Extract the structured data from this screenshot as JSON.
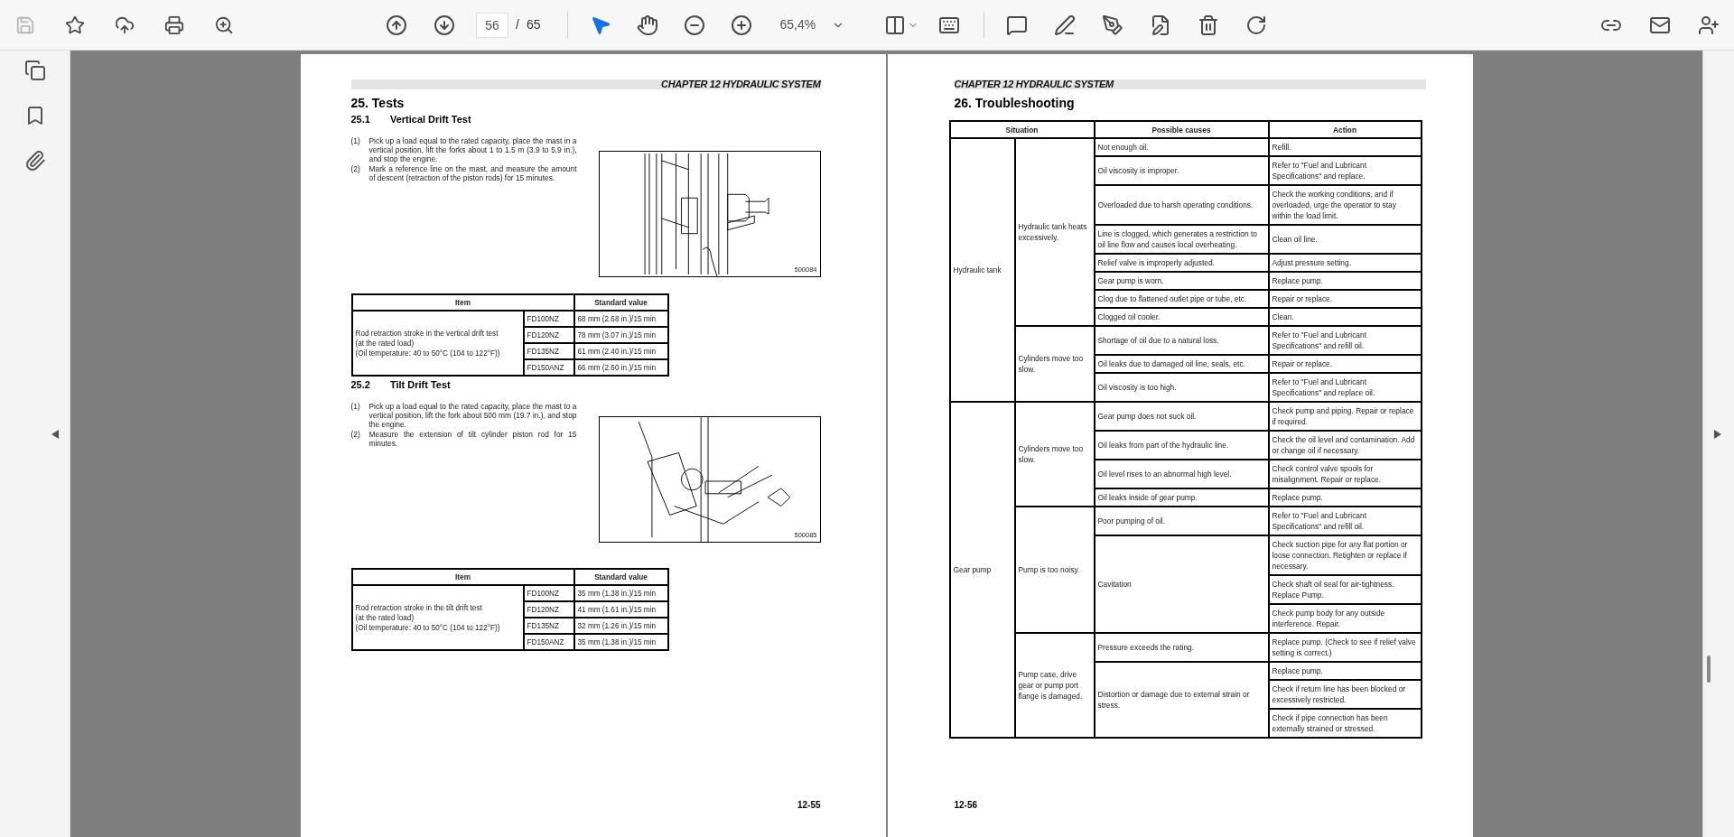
{
  "toolbar": {
    "save_disabled": true,
    "page_number": "56",
    "page_separator": "/",
    "page_total": "65",
    "select_tools": [
      {
        "selected": true
      },
      {
        "selected": false
      }
    ],
    "zoom": "65,4%"
  },
  "pages": [
    {
      "chapter": "CHAPTER 12  HYDRAULIC SYSTEM",
      "folio": "12-55",
      "sections": [
        {
          "heading": "25.  Tests",
          "subheading_number": "25.1",
          "subheading": "Vertical Drift Test",
          "steps": [
            {
              "number": "(1)",
              "text": "Pick up a load equal to the rated capacity, place the mast in a vertical position, lift the forks about 1 to 1.5 m (3.9 to 5.9 in.), and stop the engine."
            },
            {
              "number": "(2)",
              "text": "Mark a reference line on the mast, and measure the amount of descent (retraction of the piston rods) for 15 minutes."
            }
          ],
          "figure_code": "500084",
          "table": {
            "columns": [
              "Item",
              "Standard value"
            ],
            "item": [
              "Rod retraction stroke in the vertical drift test",
              "(at the rated load)",
              "(Oil temperature: 40 to 50°C (104 to 122°F))"
            ],
            "rows": [
              [
                "FD100NZ",
                "68 mm (2.68 in.)/15 min"
              ],
              [
                "FD120NZ",
                "78 mm (3.07 in.)/15 min"
              ],
              [
                "FD135NZ",
                "61 mm (2.40 in.)/15 min"
              ],
              [
                "FD150ANZ",
                "66 mm (2.60 in.)/15 min"
              ]
            ]
          }
        },
        {
          "subheading_number": "25.2",
          "subheading": "Tilt Drift Test",
          "steps": [
            {
              "number": "(1)",
              "text": "Pick up a load equal to the rated capacity, place the mast to a vertical position, lift the fork about 500 mm (19.7 in.), and stop the engine."
            },
            {
              "number": "(2)",
              "text": "Measure the extension of tilt cylinder piston rod for 15 minutes."
            }
          ],
          "figure_code": "500085",
          "table": {
            "columns": [
              "Item",
              "Standard value"
            ],
            "item": [
              "Rod retraction stroke in the tilt drift test",
              "(at the rated load)",
              "(Oil temperature: 40 to 50°C (104 to 122°F))"
            ],
            "rows": [
              [
                "FD100NZ",
                "35 mm (1.38 in.)/15 min"
              ],
              [
                "FD120NZ",
                "41 mm (1.61 in.)/15 min"
              ],
              [
                "FD135NZ",
                "32 mm (1.26 in.)/15 min"
              ],
              [
                "FD150ANZ",
                "35 mm (1.38 in.)/15 min"
              ]
            ]
          }
        }
      ]
    },
    {
      "chapter": "CHAPTER 12  HYDRAULIC SYSTEM",
      "folio": "12-56",
      "heading": "26.  Troubleshooting",
      "troubleshooting": {
        "columns": [
          "Situation",
          "Possible causes",
          "Action"
        ],
        "situations": [
          {
            "situation": "Hydraulic tank",
            "symptoms": [
              {
                "symptom": "Hydraulic tank heats excessively.",
                "causes": [
                  {
                    "cause": "Not enough oil.",
                    "actions": [
                      "Refill."
                    ]
                  },
                  {
                    "cause": "Oil viscosity is improper.",
                    "actions": [
                      "Refer to \"Fuel and Lubricant Specifications\" and replace."
                    ]
                  },
                  {
                    "cause": "Overloaded due to harsh operating conditions.",
                    "actions": [
                      "Check the working conditions, and if overloaded, urge the operator to stay within the load limit."
                    ]
                  },
                  {
                    "cause": "Line is clogged, which generates a restriction to oil line flow and causes local overheating.",
                    "actions": [
                      "Clean oil line."
                    ]
                  },
                  {
                    "cause": "Relief valve is improperly adjusted.",
                    "actions": [
                      "Adjust pressure setting."
                    ]
                  },
                  {
                    "cause": "Gear pump is worn.",
                    "actions": [
                      "Replace pump."
                    ]
                  },
                  {
                    "cause": "Clog due to flattened outlet pipe or tube, etc.",
                    "actions": [
                      "Repair or replace."
                    ]
                  },
                  {
                    "cause": "Clogged oil cooler.",
                    "actions": [
                      "Clean."
                    ]
                  }
                ]
              },
              {
                "symptom": "Cylinders move too slow.",
                "causes": [
                  {
                    "cause": "Shortage of oil due to a natural loss.",
                    "actions": [
                      "Refer to \"Fuel and Lubricant Specifications\" and refill oil."
                    ]
                  },
                  {
                    "cause": "Oil leaks due to damaged oil line, seals, etc.",
                    "actions": [
                      "Repair or replace."
                    ]
                  },
                  {
                    "cause": "Oil viscosity is too high.",
                    "actions": [
                      "Refer to \"Fuel and Lubricant Specifications\" and replace oil."
                    ]
                  }
                ]
              }
            ]
          },
          {
            "situation": "Gear pump",
            "symptoms": [
              {
                "symptom": "Cylinders move too slow.",
                "causes": [
                  {
                    "cause": "Gear pump does not suck oil.",
                    "actions": [
                      "Check pump and piping. Repair or replace if required."
                    ]
                  },
                  {
                    "cause": "Oil leaks from part of the hydraulic line.",
                    "actions": [
                      "Check the oil level and contamination. Add or change oil if necessary."
                    ]
                  },
                  {
                    "cause": "Oil level rises to an abnormal high level.",
                    "actions": [
                      "Check control valve spools for misalignment. Repair or replace."
                    ]
                  },
                  {
                    "cause": "Oil leaks inside of gear pump.",
                    "actions": [
                      "Replace pump."
                    ]
                  }
                ]
              },
              {
                "symptom": "Pump is too noisy.",
                "causes": [
                  {
                    "cause": "Poor pumping of oil.",
                    "actions": [
                      "Refer to \"Fuel and Lubricant Specifications\" and refill oil."
                    ]
                  },
                  {
                    "cause": "Cavitation",
                    "actions": [
                      "Check suction pipe for any flat portion or loose connection. Retighten or replace if necessary.",
                      "Check shaft oil seal for air-tightness. Replace Pump.",
                      "Check pump body for any outside interference. Repair."
                    ]
                  }
                ]
              },
              {
                "symptom": "Pump case, drive gear or pump port flange is damaged.",
                "causes": [
                  {
                    "cause": "Pressure exceeds the rating.",
                    "actions": [
                      "Replace pump. (Check to see if relief valve setting is correct.)"
                    ]
                  },
                  {
                    "cause": "Distortion or damage due to external strain or stress.",
                    "actions": [
                      "Replace pump.",
                      "Check if return line has been blocked or excessively restricted.",
                      "Check if pipe connection has been externally strained or stressed."
                    ]
                  }
                ]
              }
            ]
          }
        ]
      }
    }
  ]
}
